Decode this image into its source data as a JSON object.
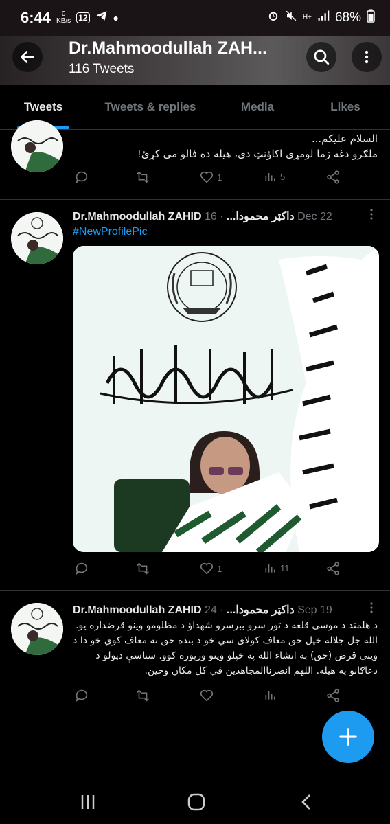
{
  "status_bar": {
    "time": "6:44",
    "kbs_top": "0",
    "kbs_bottom": "KB/s",
    "notif_count": "12",
    "net_top": "H+",
    "battery": "68%"
  },
  "header": {
    "title": "Dr.Mahmoodullah ZAH...",
    "subtitle": "116 Tweets"
  },
  "tabs": [
    {
      "label": "Tweets",
      "active": true
    },
    {
      "label": "Tweets & replies",
      "active": false
    },
    {
      "label": "Media",
      "active": false
    },
    {
      "label": "Likes",
      "active": false
    }
  ],
  "tweets": [
    {
      "text_line1": "السلام علیکم...",
      "text_line2": "ملګرو دغه زما لومړی اکاؤنټ دی، هیله ده فالو می کړئ!",
      "likes": "1",
      "views": "5"
    },
    {
      "name": "Dr.Mahmoodullah ZAHID داکټر محمودا...",
      "date": "· 16 Dec 22",
      "hashtag": "#NewProfilePic",
      "likes": "1",
      "views": "11"
    },
    {
      "name": "Dr.Mahmoodullah ZAHID داکټر محمودا...",
      "date": "· 24 Sep 19",
      "text": "د هلمند د موسی قلعه د تور سرو ببرسرو شهداؤ د مظلومو وینو قرضداره یو. الله جل جلاله خپل حق معاف کولای سي خو د بنده حق نه معاف کوي خو دا د وینې قرض (حق) به انشاء الله په خپلو وینو ورپوره کوو. ستاسې دټولو د دعاګانو په هیله. اللهم انصرناالمجاهدین في کل مکان وحین.",
      "likes": "",
      "views": ""
    }
  ],
  "colors": {
    "accent": "#1d9bf0",
    "secondary_text": "#71767b",
    "divider": "#2f3336"
  }
}
